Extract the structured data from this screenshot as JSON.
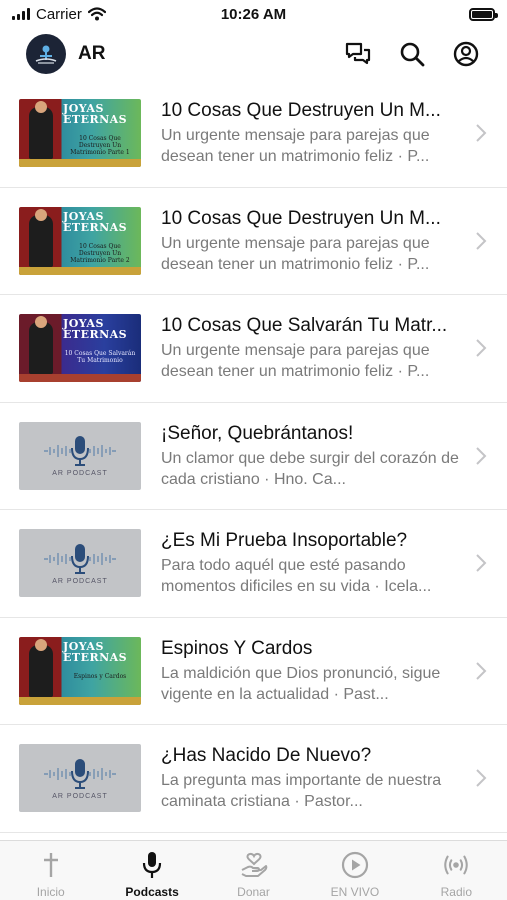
{
  "status_bar": {
    "carrier": "Carrier",
    "time": "10:26 AM"
  },
  "header": {
    "avatar_text": "AR",
    "title": "AR"
  },
  "episodes": [
    {
      "thumb": "joyas",
      "thumb_title": "JOYAS ETERNAS",
      "thumb_sub": "10 Cosas Que Destruyen Un Matrimonio Parte 1",
      "title": "10 Cosas Que Destruyen Un M...",
      "description": "Un urgente mensaje para parejas que desean tener un matrimonio feliz · P..."
    },
    {
      "thumb": "joyas",
      "thumb_title": "JOYAS ETERNAS",
      "thumb_sub": "10 Cosas Que Destruyen Un Matrimonio Parte 2",
      "title": "10 Cosas Que Destruyen Un M...",
      "description": "Un urgente mensaje para parejas que desean tener un matrimonio feliz · P..."
    },
    {
      "thumb": "joyas-blue",
      "thumb_title": "JOYAS ETERNAS",
      "thumb_sub": "10 Cosas Que Salvarán Tu Matrimonio",
      "title": "10 Cosas Que Salvarán Tu Matr...",
      "description": "Un urgente mensaje para parejas que desean tener un matrimonio feliz · P..."
    },
    {
      "thumb": "podcast",
      "thumb_title": "AR PODCAST",
      "title": "¡Señor, Quebrántanos!",
      "description": "Un clamor que debe surgir del corazón de cada cristiano · Hno. Ca..."
    },
    {
      "thumb": "podcast",
      "thumb_title": "AR PODCAST",
      "title": "¿Es Mi Prueba Insoportable?",
      "description": "Para todo aquél que esté pasando momentos dificiles en su vida · Icela..."
    },
    {
      "thumb": "joyas",
      "thumb_title": "JOYAS ETERNAS",
      "thumb_sub": "Espinos y Cardos",
      "title": "Espinos Y Cardos",
      "description": "La maldición que Dios pronunció, sigue vigente en la actualidad · Past..."
    },
    {
      "thumb": "podcast",
      "thumb_title": "AR PODCAST",
      "title": "¿Has Nacido De Nuevo?",
      "description": "La pregunta mas importante de nuestra caminata cristiana · Pastor..."
    }
  ],
  "tabs": [
    {
      "label": "Inicio",
      "icon": "cross-icon",
      "active": false
    },
    {
      "label": "Podcasts",
      "icon": "microphone-icon",
      "active": true
    },
    {
      "label": "Donar",
      "icon": "donate-heart-hand-icon",
      "active": false
    },
    {
      "label": "EN VIVO",
      "icon": "play-circle-icon",
      "active": false
    },
    {
      "label": "Radio",
      "icon": "radio-broadcast-icon",
      "active": false
    }
  ],
  "colors": {
    "active_tab": "#111111",
    "inactive_tab": "#a5a5a5",
    "description": "#7a7a7a"
  }
}
